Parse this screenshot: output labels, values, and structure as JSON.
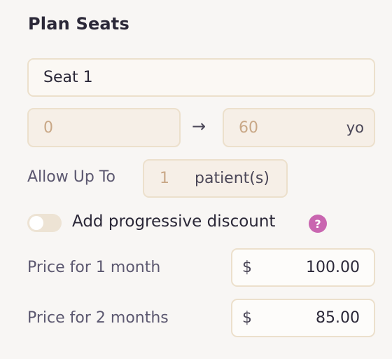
{
  "section": {
    "title": "Plan Seats"
  },
  "seat": {
    "name": "Seat 1"
  },
  "age_range": {
    "from": "0",
    "arrow": "→",
    "to": "60",
    "unit": "yo"
  },
  "capacity": {
    "label": "Allow Up To",
    "value": "1",
    "unit": "patient(s)"
  },
  "discount": {
    "enabled": false,
    "label": "Add progressive discount",
    "help_glyph": "?"
  },
  "prices": [
    {
      "label": "Price for 1 month",
      "currency": "$",
      "amount": "100.00"
    },
    {
      "label": "Price for 2 months",
      "currency": "$",
      "amount": "85.00"
    }
  ],
  "colors": {
    "accent": "#c966b0",
    "field_border": "#ece0cc",
    "placeholder": "#c9a887"
  }
}
